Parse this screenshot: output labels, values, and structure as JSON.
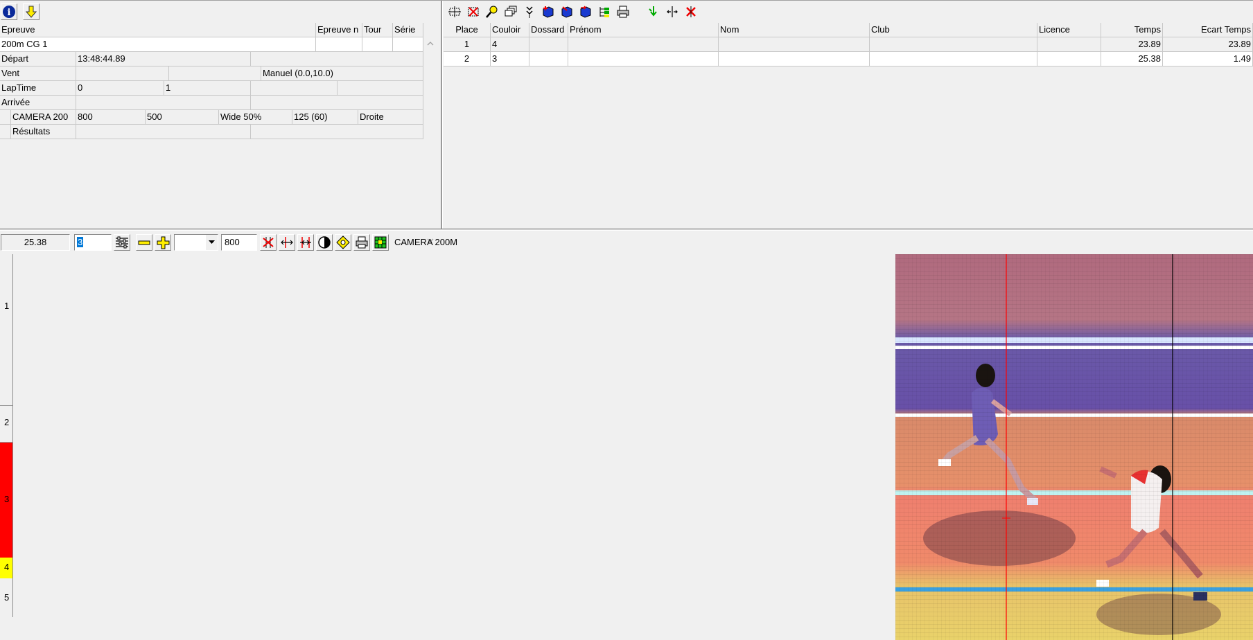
{
  "left_toolbar": [
    {
      "icon": "info-icon"
    },
    {
      "icon": "download-arrow-icon"
    }
  ],
  "event_table": {
    "headers": [
      "Epreuve",
      "Epreuve n",
      "Tour",
      "Série"
    ],
    "event_name": "200m CG 1",
    "rows": [
      {
        "label": "Départ",
        "c1": "13:48:44.89",
        "c2": ""
      },
      {
        "label": "Vent",
        "c1": "",
        "c2": "",
        "c3": "Manuel (0.0,10.0)"
      },
      {
        "label": "LapTime",
        "c1": "0",
        "c2": "1"
      },
      {
        "label": "Arrivée",
        "c1": "",
        "c2": ""
      }
    ],
    "camera_row": {
      "name": "CAMERA 200",
      "v1": "800",
      "v2": "500",
      "v3": "Wide 50%",
      "v4": "125  (60)",
      "v5": "Droite"
    },
    "results_row": {
      "name": "Résultats"
    }
  },
  "right_toolbar": [
    {
      "icon": "select-area-icon"
    },
    {
      "icon": "delete-area-icon"
    },
    {
      "icon": "zoom-icon"
    },
    {
      "icon": "copy-windows-icon"
    },
    {
      "icon": "expand-down-icon"
    },
    {
      "icon": "add-book-icon"
    },
    {
      "icon": "edit-book-icon"
    },
    {
      "icon": "send-book-icon"
    },
    {
      "icon": "tree-icon"
    },
    {
      "icon": "print-icon"
    },
    {
      "icon": "check-arrow-icon"
    },
    {
      "icon": "split-icon"
    },
    {
      "icon": "close-red-icon"
    }
  ],
  "results_table": {
    "headers": [
      "Place",
      "Couloir",
      "Dossard",
      "Prénom",
      "Nom",
      "Club",
      "Licence",
      "Temps",
      "Ecart Temps"
    ],
    "rows": [
      {
        "place": "1",
        "couloir": "4",
        "dossard": "",
        "prenom": "",
        "nom": "",
        "club": "",
        "licence": "",
        "temps": "23.89",
        "ecart": "23.89"
      },
      {
        "place": "2",
        "couloir": "3",
        "dossard": "",
        "prenom": "",
        "nom": "",
        "club": "",
        "licence": "",
        "temps": "25.38",
        "ecart": "1.49"
      }
    ]
  },
  "image_toolbar": {
    "time_value": "25.38",
    "cursor_input": "3",
    "dropdown_value": "",
    "width_value": "800",
    "camera_label": "CAMERA 200M"
  },
  "lanes": [
    {
      "label": "1"
    },
    {
      "label": "2"
    },
    {
      "label": "3",
      "color": "#ff0000"
    },
    {
      "label": "4",
      "color": "#ffff00"
    },
    {
      "label": "5"
    }
  ]
}
